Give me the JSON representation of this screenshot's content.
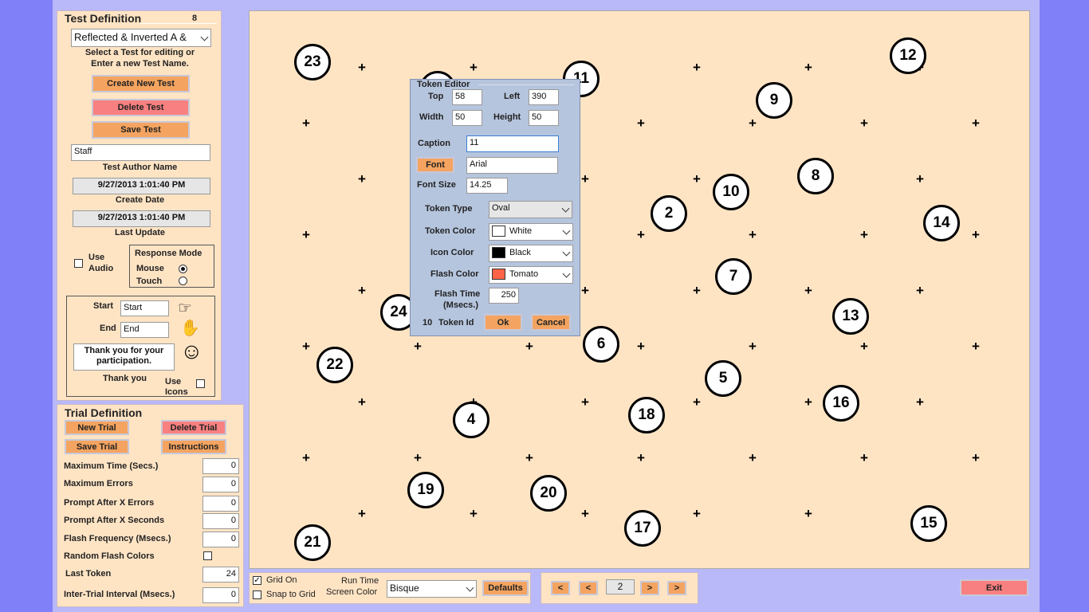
{
  "test_definition": {
    "header": "Test Definition",
    "count": "8",
    "selected_test": "Reflected & Inverted A &",
    "select_hint_line1": "Select a Test for editing or",
    "select_hint_line2": "Enter a new Test Name.",
    "create_label": "Create New Test",
    "delete_label": "Delete Test",
    "save_label": "Save Test",
    "author_value": "Staff",
    "author_caption": "Test Author Name",
    "create_date_value": "9/27/2013 1:01:40 PM",
    "create_date_caption": "Create Date",
    "update_value": "9/27/2013 1:01:40 PM",
    "update_caption": "Last Update",
    "use_audio_line1": "Use",
    "use_audio_line2": "Audio",
    "response_mode_title": "Response Mode",
    "mouse_label": "Mouse",
    "touch_label": "Touch",
    "start_label": "Start",
    "start_value": "Start",
    "end_label": "End",
    "end_value": "End",
    "thank_text_line1": "Thank you for your",
    "thank_text_line2": "participation.",
    "thank_caption": "Thank you",
    "use_icons_line1": "Use",
    "use_icons_line2": "Icons"
  },
  "trial_definition": {
    "header": "Trial Definition",
    "new_label": "New Trial",
    "delete_label": "Delete Trial",
    "save_label": "Save Trial",
    "instructions_label": "Instructions",
    "max_time_label": "Maximum Time (Secs.)",
    "max_time_value": "0",
    "max_errors_label": "Maximum Errors",
    "max_errors_value": "0",
    "prompt_errors_label": "Prompt After X Errors",
    "prompt_errors_value": "0",
    "prompt_seconds_label": "Prompt After X Seconds",
    "prompt_seconds_value": "0",
    "flash_freq_label": "Flash Frequency (Msecs.)",
    "flash_freq_value": "0",
    "random_flash_label": "Random Flash Colors",
    "last_token_label": "Last Token",
    "last_token_value": "24",
    "inter_trial_label": "Inter-Trial Interval (Msecs.)",
    "inter_trial_value": "0"
  },
  "tokens": [
    "23",
    "11",
    "12",
    "9",
    "8",
    "10",
    "2",
    "14",
    "7",
    "24",
    "13",
    "6",
    "22",
    "5",
    "16",
    "18",
    "4",
    "19",
    "20",
    "17",
    "15",
    "21"
  ],
  "token_editor": {
    "title": "Token Editor",
    "top_label": "Top",
    "top_value": "58",
    "left_label": "Left",
    "left_value": "390",
    "width_label": "Width",
    "width_value": "50",
    "height_label": "Height",
    "height_value": "50",
    "caption_label": "Caption",
    "caption_value": "11",
    "font_button": "Font",
    "font_value": "Arial",
    "font_size_label": "Font Size",
    "font_size_value": "14.25",
    "token_type_label": "Token Type",
    "token_type_value": "Oval",
    "token_color_label": "Token Color",
    "token_color_value": "White",
    "token_color_hex": "#ffffff",
    "icon_color_label": "Icon Color",
    "icon_color_value": "Black",
    "icon_color_hex": "#000000",
    "flash_color_label": "Flash Color",
    "flash_color_value": "Tomato",
    "flash_color_hex": "#ff6347",
    "flash_time_line1": "Flash Time",
    "flash_time_line2": "(Msecs.)",
    "flash_time_value": "250",
    "token_id_value": "10",
    "token_id_label": "Token Id",
    "ok_label": "Ok",
    "cancel_label": "Cancel"
  },
  "bottom_bar": {
    "grid_on_label": "Grid On",
    "snap_label": "Snap to Grid",
    "run_time_line1": "Run Time",
    "run_time_line2": "Screen Color",
    "screen_color_value": "Bisque",
    "defaults_label": "Defaults",
    "nav_first": "<",
    "nav_prev": "<",
    "page_value": "2",
    "nav_next": ">",
    "nav_last": ">",
    "exit_label": "Exit"
  },
  "colors": {
    "canvas": "#ffe4c4",
    "orange_button": "#f4a460",
    "red_button": "#f88080",
    "background": "#b9b9fa"
  }
}
